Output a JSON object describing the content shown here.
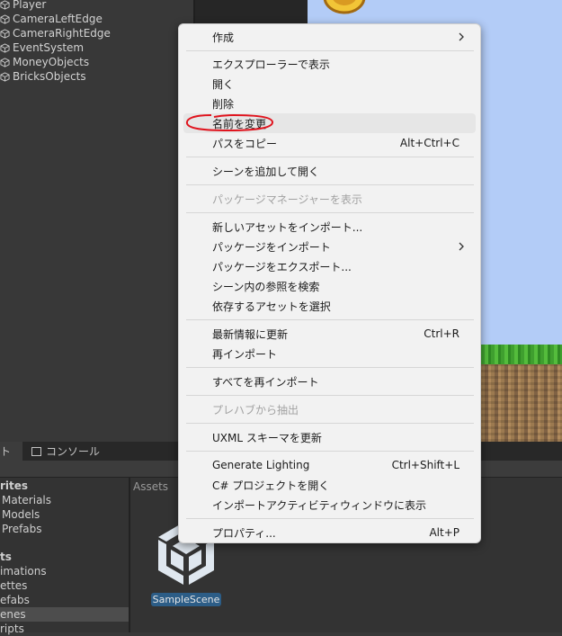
{
  "hierarchy": {
    "items": [
      {
        "label": "Player"
      },
      {
        "label": "CameraLeftEdge"
      },
      {
        "label": "CameraRightEdge"
      },
      {
        "label": "EventSystem"
      },
      {
        "label": "MoneyObjects"
      },
      {
        "label": "BricksObjects"
      }
    ]
  },
  "bottom_tabs": {
    "project_label": "ト",
    "console_label": "コンソール"
  },
  "project_tree": {
    "items": [
      {
        "label": "rites",
        "bold": true
      },
      {
        "label": "Materials"
      },
      {
        "label": "Models"
      },
      {
        "label": "Prefabs"
      },
      {
        "label": "ts",
        "bold": true
      },
      {
        "label": "imations"
      },
      {
        "label": "ettes"
      },
      {
        "label": "efabs"
      },
      {
        "label": "enes",
        "selected": true
      },
      {
        "label": "ripts"
      }
    ]
  },
  "assets": {
    "breadcrumb": "Assets",
    "scene_asset_label": "SampleScene"
  },
  "context_menu": {
    "items": [
      {
        "label": "作成",
        "submenu": true
      },
      {
        "label": "エクスプローラーで表示"
      },
      {
        "label": "開く"
      },
      {
        "label": "削除"
      },
      {
        "label": "名前を変更",
        "highlighted": true
      },
      {
        "label": "パスをコピー",
        "shortcut": "Alt+Ctrl+C"
      },
      {
        "label": "シーンを追加して開く"
      },
      {
        "label": "パッケージマネージャーを表示",
        "disabled": true
      },
      {
        "label": "新しいアセットをインポート..."
      },
      {
        "label": "パッケージをインポート",
        "submenu": true
      },
      {
        "label": "パッケージをエクスポート..."
      },
      {
        "label": "シーン内の参照を検索"
      },
      {
        "label": "依存するアセットを選択"
      },
      {
        "label": "最新情報に更新",
        "shortcut": "Ctrl+R"
      },
      {
        "label": "再インポート"
      },
      {
        "label": "すべてを再インポート"
      },
      {
        "label": "プレハブから抽出",
        "disabled": true
      },
      {
        "label": "UXML スキーマを更新"
      },
      {
        "label": "Generate Lighting",
        "shortcut": "Ctrl+Shift+L"
      },
      {
        "label": "C# プロジェクトを開く"
      },
      {
        "label": "インポートアクティビティウィンドウに表示"
      },
      {
        "label": "プロパティ...",
        "shortcut": "Alt+P"
      }
    ]
  },
  "colors": {
    "editor_bg": "#383838",
    "menu_bg": "#f2f2f2",
    "annotation_red": "#e0141e",
    "selected_asset": "#2c5d87",
    "sky": "#b3ccf7"
  }
}
